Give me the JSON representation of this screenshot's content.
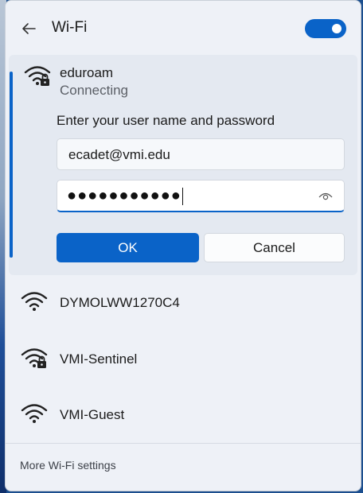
{
  "header": {
    "title": "Wi-Fi",
    "back_icon": "back-arrow-icon",
    "toggle_state": "on"
  },
  "connecting": {
    "name": "eduroam",
    "status": "Connecting",
    "prompt": "Enter your user name and password",
    "username_value": "ecadet@vmi.edu",
    "password_masked": "●●●●●●●●●●●",
    "ok_label": "OK",
    "cancel_label": "Cancel",
    "icon": "wifi-secured-icon"
  },
  "networks": [
    {
      "name": "DYMOLWW1270C4",
      "icon": "wifi-icon"
    },
    {
      "name": "VMI-Sentinel",
      "icon": "wifi-secured-icon"
    },
    {
      "name": "VMI-Guest",
      "icon": "wifi-icon"
    }
  ],
  "footer": {
    "link": "More Wi-Fi settings"
  },
  "colors": {
    "accent": "#0a63c8",
    "panel": "#eef1f7",
    "selected": "#e4e9f1"
  }
}
